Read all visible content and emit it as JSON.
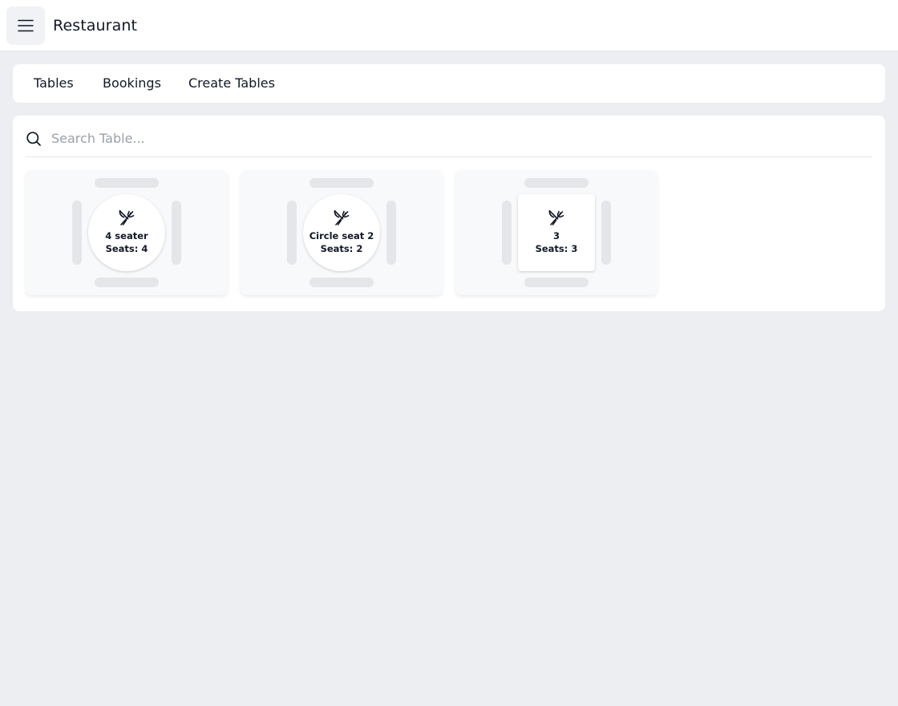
{
  "header": {
    "menu_icon": "hamburger-icon",
    "title": "Restaurant"
  },
  "nav": {
    "items": [
      {
        "label": "Tables"
      },
      {
        "label": "Bookings"
      },
      {
        "label": "Create Tables"
      }
    ]
  },
  "search": {
    "icon": "search-icon",
    "placeholder": "Search Table...",
    "value": ""
  },
  "tables": [
    {
      "name": "4 seater",
      "seats_label": "Seats: 4",
      "shape": "circle",
      "icon": "fork-knife-icon"
    },
    {
      "name": "Circle seat 2",
      "seats_label": "Seats: 2",
      "shape": "circle",
      "icon": "fork-knife-icon"
    },
    {
      "name": "3",
      "seats_label": "Seats: 3",
      "shape": "square",
      "icon": "fork-knife-icon"
    }
  ]
}
